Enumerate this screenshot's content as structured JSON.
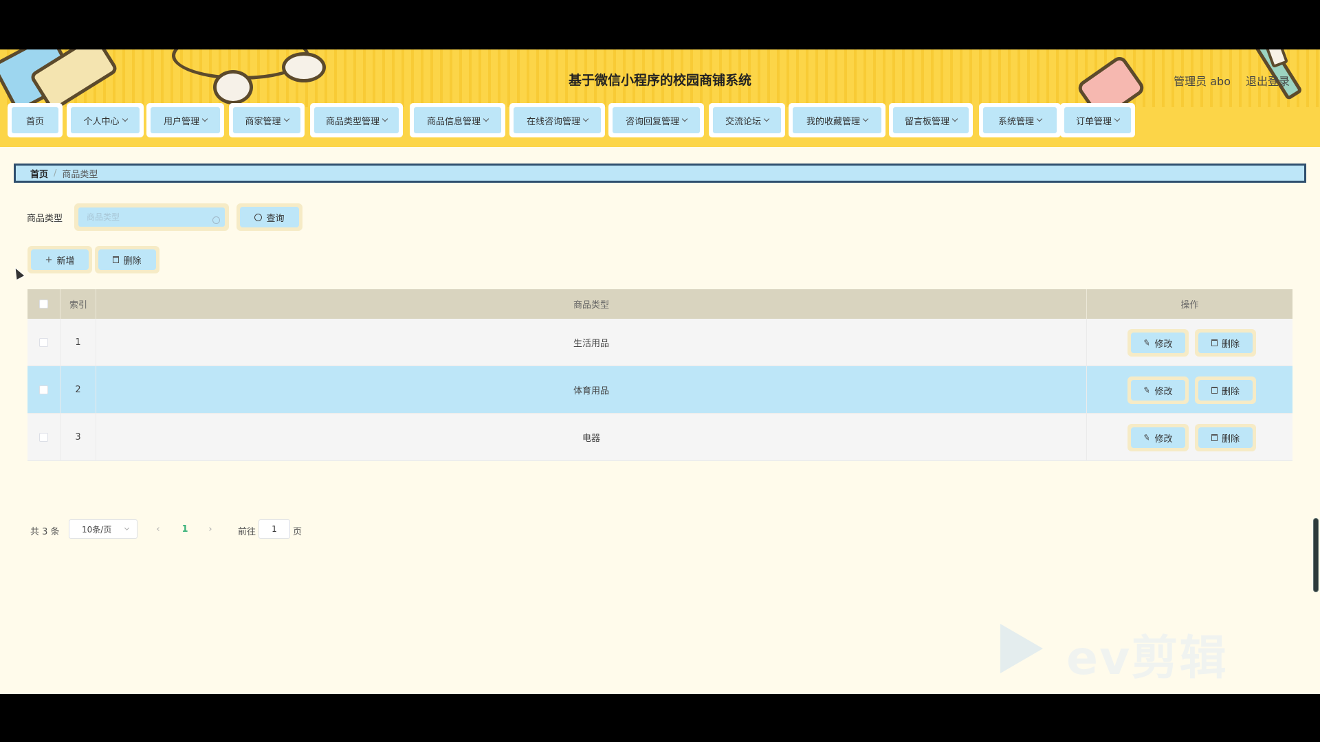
{
  "header": {
    "title": "基于微信小程序的校园商铺系统",
    "user": "管理员 abo",
    "logout": "退出登录"
  },
  "nav": [
    {
      "label": "首页",
      "dropdown": false
    },
    {
      "label": "个人中心",
      "dropdown": true
    },
    {
      "label": "用户管理",
      "dropdown": true
    },
    {
      "label": "商家管理",
      "dropdown": true
    },
    {
      "label": "商品类型管理",
      "dropdown": true
    },
    {
      "label": "商品信息管理",
      "dropdown": true
    },
    {
      "label": "在线咨询管理",
      "dropdown": true
    },
    {
      "label": "咨询回复管理",
      "dropdown": true
    },
    {
      "label": "交流论坛",
      "dropdown": true
    },
    {
      "label": "我的收藏管理",
      "dropdown": true
    },
    {
      "label": "留言板管理",
      "dropdown": true
    },
    {
      "label": "系统管理",
      "dropdown": true
    },
    {
      "label": "订单管理",
      "dropdown": true
    }
  ],
  "breadcrumb": {
    "home": "首页",
    "separator": "/",
    "current": "商品类型"
  },
  "search": {
    "label": "商品类型",
    "placeholder": "商品类型",
    "value": "",
    "button": "查询"
  },
  "actions": {
    "add": "新增",
    "delete": "删除"
  },
  "table": {
    "columns": {
      "index": "索引",
      "type": "商品类型",
      "ops": "操作"
    },
    "rows": [
      {
        "index": "1",
        "type": "生活用品",
        "edit": "修改",
        "delete": "删除"
      },
      {
        "index": "2",
        "type": "体育用品",
        "edit": "修改",
        "delete": "删除"
      },
      {
        "index": "3",
        "type": "电器",
        "edit": "修改",
        "delete": "删除"
      }
    ]
  },
  "pagination": {
    "total": "共 3 条",
    "page_size": "10条/页",
    "prev": "‹",
    "next": "›",
    "current": "1",
    "goto_label": "前往",
    "goto_value": "1",
    "page_suffix": "页"
  },
  "watermark": {
    "text": "ev剪辑"
  },
  "colors": {
    "header_yellow": "#fcd548",
    "button_blue": "#bde6f8",
    "page_bg": "#fffbeb",
    "table_header": "#d9d4bf",
    "active_page": "#3bb27a"
  }
}
